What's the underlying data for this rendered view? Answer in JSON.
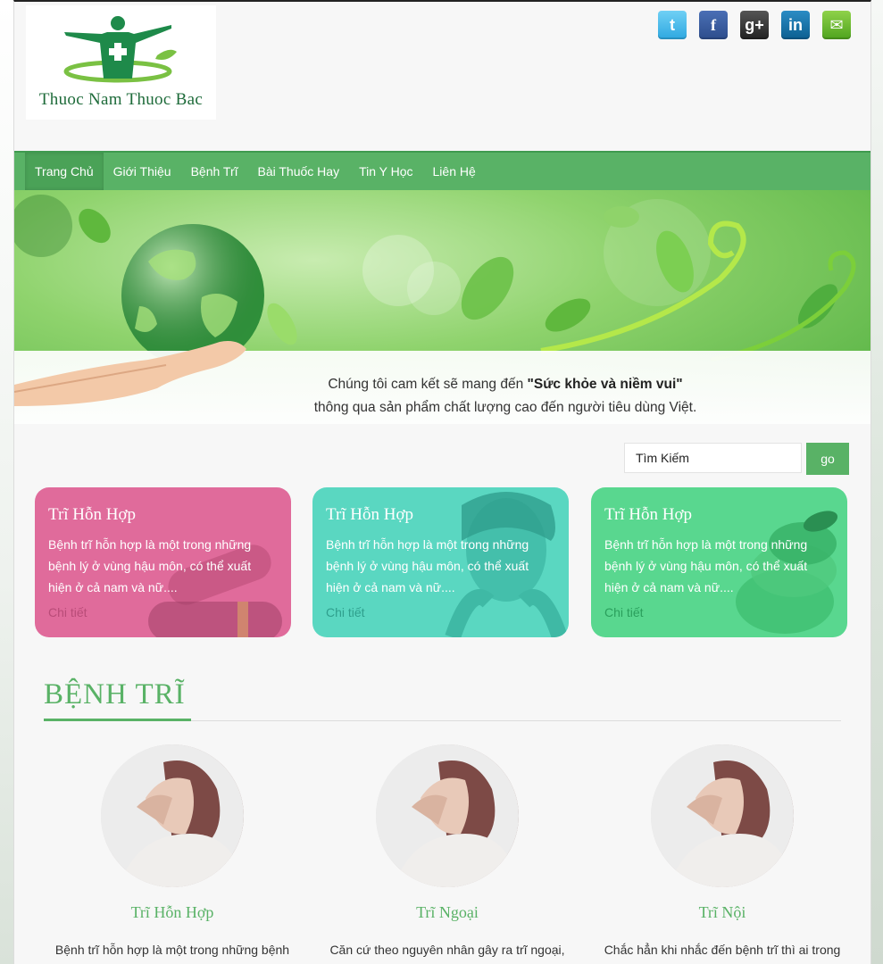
{
  "brand": {
    "logo_text": "Thuoc Nam Thuoc Bac"
  },
  "social": [
    {
      "icon": "twitter-icon",
      "glyph": "t"
    },
    {
      "icon": "facebook-icon",
      "glyph": "f"
    },
    {
      "icon": "google-plus-icon",
      "glyph": "g+"
    },
    {
      "icon": "linkedin-icon",
      "glyph": "in"
    },
    {
      "icon": "email-icon",
      "glyph": "✉"
    }
  ],
  "nav": {
    "items": [
      "Trang Chủ",
      "Giới Thiệu",
      "Bệnh Trĩ",
      "Bài Thuốc Hay",
      "Tin Y Học",
      "Liên Hệ"
    ],
    "active": "Trang Chủ"
  },
  "banner": {
    "line1_prefix": "Chúng tôi cam kết sẽ mang đến ",
    "line1_bold": "\"Sức khỏe và niềm vui\"",
    "line2": "thông qua sản phẩm chất lượng cao đến người tiêu dùng Việt."
  },
  "search": {
    "value": "Tìm Kiếm",
    "button": "go"
  },
  "cards": [
    {
      "title": "Trĩ Hỗn Hợp",
      "text": "Bệnh trĩ hỗn hợp là một trong những bệnh lý ở vùng hậu môn, có thể xuất hiện ở cả nam và nữ....",
      "more": "Chi tiết"
    },
    {
      "title": "Trĩ Hỗn Hợp",
      "text": "Bệnh trĩ hỗn hợp là một trong những bệnh lý ở vùng hậu môn, có thể xuất hiện ở cả nam và nữ....",
      "more": "Chi tiết"
    },
    {
      "title": "Trĩ Hỗn Hợp",
      "text": "Bệnh trĩ hỗn hợp là một trong những bệnh lý ở vùng hậu môn, có thể xuất hiện ở cả nam và nữ....",
      "more": "Chi tiết"
    }
  ],
  "section": {
    "title": "BỆNH TRĨ",
    "items": [
      {
        "title": "Trĩ Hỗn Hợp",
        "text": "Bệnh trĩ hỗn hợp là một trong những bệnh"
      },
      {
        "title": "Trĩ Ngoại",
        "text": "Căn cứ theo nguyên nhân gây ra trĩ ngoại,"
      },
      {
        "title": "Trĩ Nội",
        "text": "Chắc hẳn khi nhắc đến bệnh trĩ thì ai trong"
      }
    ]
  },
  "colors": {
    "accent": "#59b266",
    "pink": "#e06b9b",
    "teal": "#5ad7c1",
    "green": "#59d78f"
  }
}
